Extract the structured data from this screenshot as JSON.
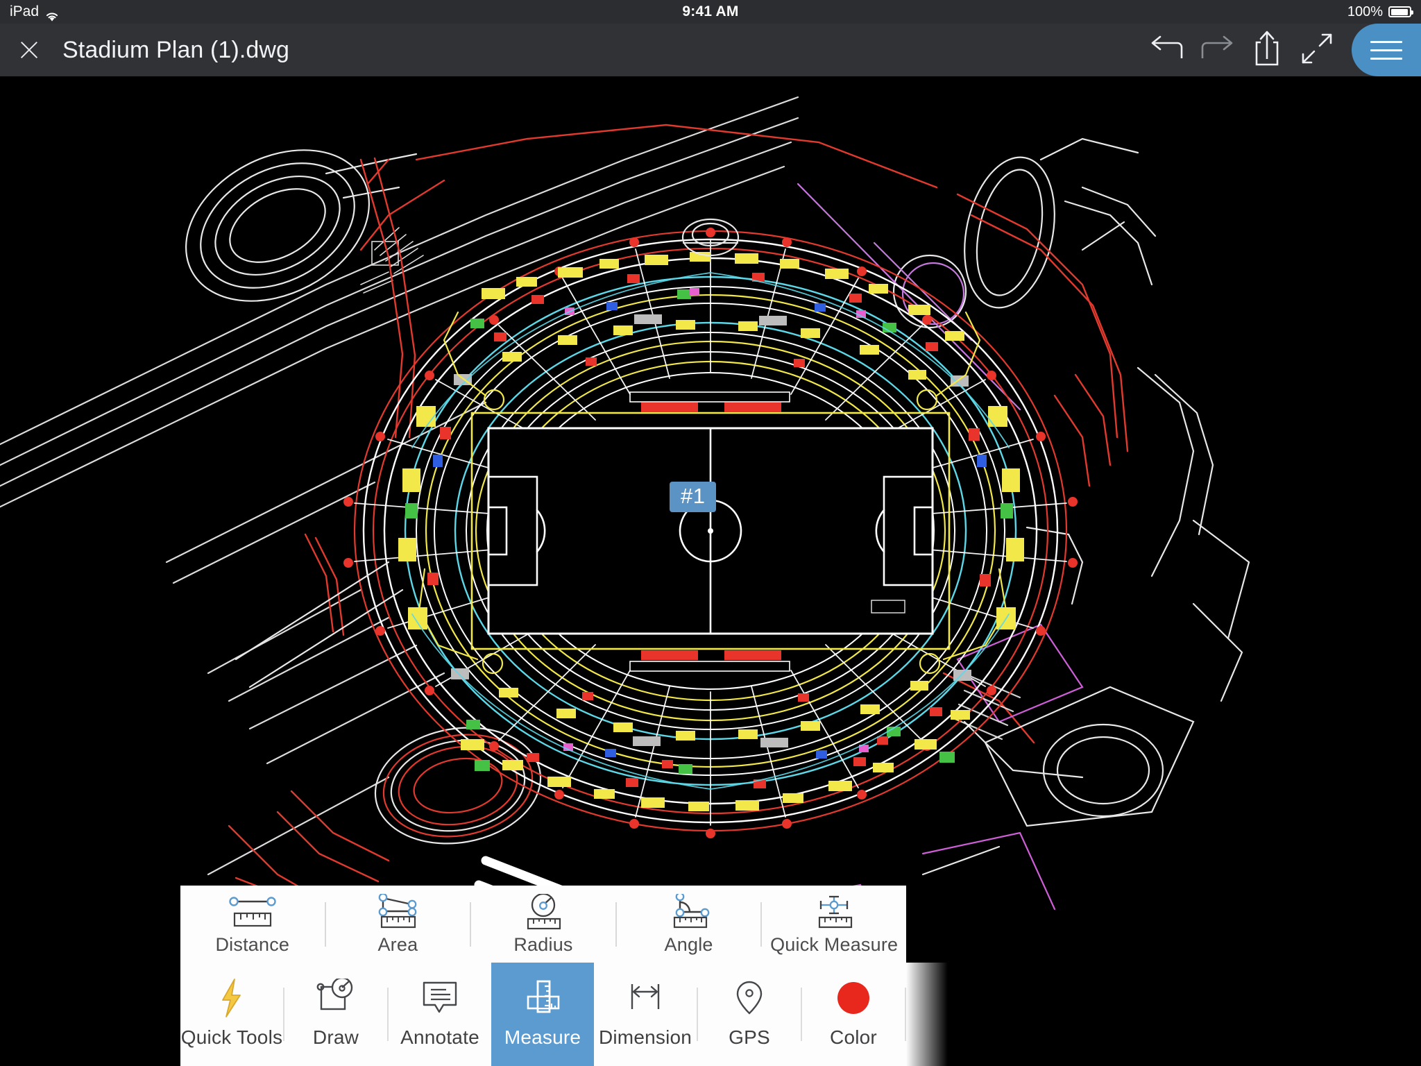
{
  "status_bar": {
    "device": "iPad",
    "wifi_icon": "wifi-icon",
    "time": "9:41 AM",
    "battery_percent": "100%",
    "battery_icon": "battery-full-icon"
  },
  "header": {
    "close_icon": "close-icon",
    "title": "Stadium Plan (1).dwg",
    "actions": [
      {
        "name": "undo-button",
        "icon": "undo-arrow-icon",
        "enabled": true
      },
      {
        "name": "redo-button",
        "icon": "redo-arrow-icon",
        "enabled": false
      },
      {
        "name": "share-button",
        "icon": "share-up-arrow-icon",
        "enabled": true
      },
      {
        "name": "fullscreen-button",
        "icon": "expand-diagonal-arrows-icon",
        "enabled": true
      }
    ],
    "menu_button": {
      "name": "hamburger-menu-button",
      "icon": "hamburger-icon",
      "color": "#4a90c4"
    }
  },
  "canvas": {
    "background": "#000000",
    "drawing_title": "Stadium site plan CAD drawing",
    "markers": [
      {
        "label": "#1",
        "color": "#5b93c4",
        "text_color": "#ffffff"
      }
    ]
  },
  "measure_toolbar": {
    "items": [
      {
        "label": "Distance",
        "icon": "distance-measure-icon"
      },
      {
        "label": "Area",
        "icon": "area-measure-icon"
      },
      {
        "label": "Radius",
        "icon": "radius-measure-icon"
      },
      {
        "label": "Angle",
        "icon": "angle-measure-icon"
      },
      {
        "label": "Quick Measure",
        "icon": "quick-measure-icon"
      }
    ]
  },
  "main_toolbar": {
    "active": "Measure",
    "items": [
      {
        "label": "Quick Tools",
        "icon": "lightning-bolt-icon",
        "active": false
      },
      {
        "label": "Draw",
        "icon": "draw-compass-icon",
        "active": false
      },
      {
        "label": "Annotate",
        "icon": "speech-bubble-icon",
        "active": false
      },
      {
        "label": "Measure",
        "icon": "crossed-rulers-icon",
        "active": true
      },
      {
        "label": "Dimension",
        "icon": "dimension-arrow-icon",
        "active": false
      },
      {
        "label": "GPS",
        "icon": "map-pin-icon",
        "active": false
      },
      {
        "label": "Color",
        "icon": "color-swatch-icon",
        "active": false,
        "swatch": "#e8271d"
      }
    ]
  },
  "theme": {
    "status_bar_bg": "#2b2d30",
    "header_bg": "#303236",
    "toolbar_bg": "#fdfdfd",
    "accent_blue": "#5b9bd0",
    "accent_red": "#e8271d",
    "divider": "#d9d9da"
  }
}
